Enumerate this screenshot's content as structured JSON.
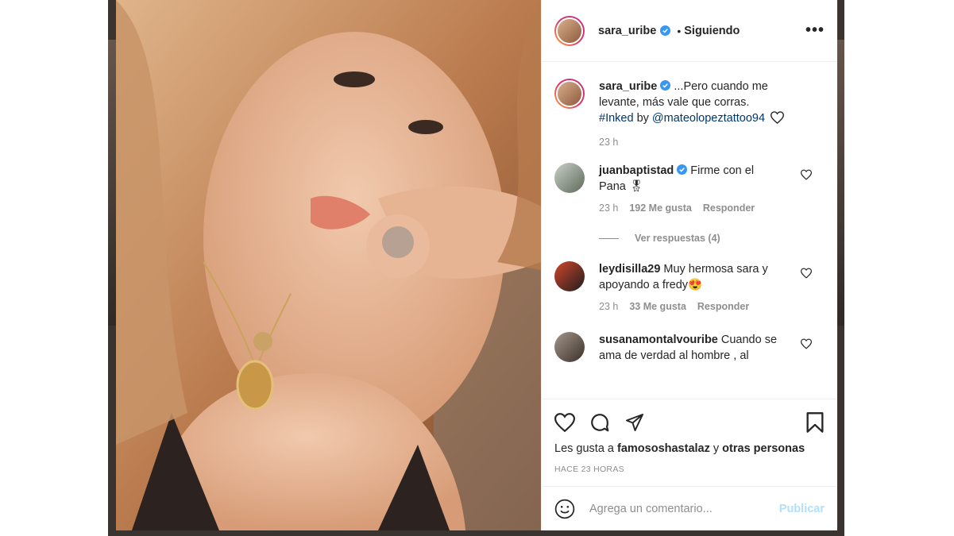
{
  "post": {
    "username": "sara_uribe",
    "follow_separator": "•",
    "follow_status": "Siguiendo",
    "more_label": "•••"
  },
  "caption": {
    "username": "sara_uribe",
    "text": "...Pero cuando me levante, más vale que corras.",
    "hashtag": "#Inked",
    "by": " by ",
    "mention": "@mateolopeztattoo94",
    "time": "23 h"
  },
  "comments": [
    {
      "username": "juanbaptistad",
      "text": "Firme con el Pana 🎖",
      "time": "23 h",
      "likes": "192 Me gusta",
      "reply": "Responder",
      "view_replies": "Ver respuestas (4)"
    },
    {
      "username": "leydisilla29",
      "text": "Muy hermosa sara y apoyando a fredy😍",
      "time": "23 h",
      "likes": "33 Me gusta",
      "reply": "Responder"
    },
    {
      "username": "susanamontalvouribe",
      "text": "Cuando se ama de verdad al hombre , al"
    }
  ],
  "likes_line": {
    "prefix": "Les gusta a ",
    "user": "famososhastalaz",
    "middle": " y ",
    "others": "otras personas"
  },
  "timestamp": "HACE 23 HORAS",
  "add_comment": {
    "placeholder": "Agrega un comentario...",
    "publish": "Publicar"
  },
  "colors": {
    "verified": "#3897f0",
    "link": "#00376b",
    "publish_disabled": "#b2dffc"
  }
}
